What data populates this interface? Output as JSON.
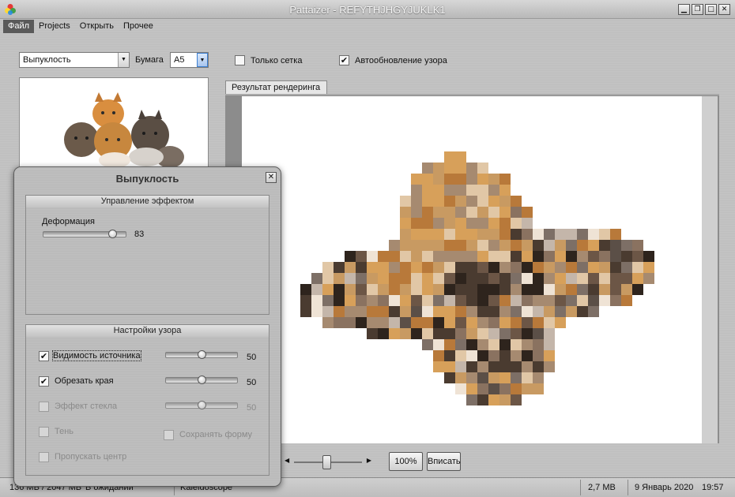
{
  "window": {
    "title": "Pattaizer - REFYTHJHGYJUKLK1",
    "controls": {
      "minimize": "▁",
      "restore": "❐",
      "maximize": "□",
      "close": "✕"
    }
  },
  "menu": {
    "items": [
      "Файл",
      "Projects",
      "Открыть",
      "Прочее"
    ],
    "active": 0
  },
  "toolbar": {
    "effect_value": "Выпуклость",
    "paper_label": "Бумага",
    "paper_value": "A5",
    "grid_only_label": "Только сетка",
    "grid_only_checked": false,
    "auto_update_label": "Автообновление узора",
    "auto_update_checked": true
  },
  "render": {
    "tab_label": "Результат рендеринга"
  },
  "bottom": {
    "zoom_fraction": 0.48,
    "zoom_button": "100%",
    "fit_button": "Вписать"
  },
  "status": {
    "memory": "136 MB / 2047 MB",
    "state": "В ожидании",
    "mode": "Kaleidoscope",
    "size": "2,7 MB",
    "date": "9 Январь 2020",
    "time": "19:57"
  },
  "dialog": {
    "title": "Выпуклость",
    "close_glyph": "✕",
    "effect_group": {
      "header": "Управление эффектом",
      "deformation_label": "Деформация",
      "deformation_value": "83",
      "deformation_fraction": 0.83
    },
    "pattern_group": {
      "header": "Настройки узора",
      "source_visibility": {
        "label": "Видимость источника",
        "checked": true,
        "value": "50",
        "fraction": 0.5
      },
      "crop_edges": {
        "label": "Обрезать края",
        "checked": true,
        "value": "50",
        "fraction": 0.5
      },
      "glass_effect": {
        "label": "Эффект стекла",
        "checked": false,
        "value": "50",
        "fraction": 0.5
      },
      "shadow": {
        "label": "Тень",
        "checked": false
      },
      "keep_shape": {
        "label": "Сохранять форму",
        "checked": false
      },
      "skip_center": {
        "label": "Пропускать центр",
        "checked": false
      }
    }
  },
  "colors": {
    "accent_menu": "#5a5a5a",
    "combo_arrow_blue": "#3c7fd1"
  }
}
